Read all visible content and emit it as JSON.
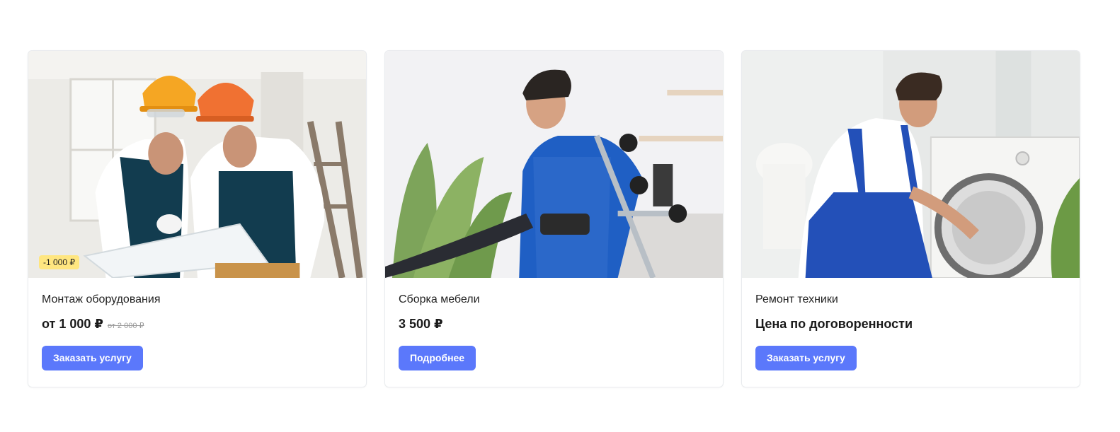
{
  "cards": [
    {
      "title": "Монтаж оборудования",
      "price": "от 1 000 ₽",
      "old_price": "от 2 000 ₽",
      "discount_badge": "-1 000 ₽",
      "button_label": "Заказать услугу",
      "image": "two-workers-hardhats-blueprint"
    },
    {
      "title": "Сборка мебели",
      "price": "3 500 ₽",
      "button_label": "Подробнее",
      "image": "worker-assembling-office-chair"
    },
    {
      "title": "Ремонт техники",
      "price": "Цена по договоренности",
      "button_label": "Заказать услугу",
      "image": "worker-repairing-washing-machine"
    }
  ],
  "colors": {
    "accent": "#5b78fb",
    "badge": "#ffe680",
    "card_border": "#e9ebee"
  }
}
